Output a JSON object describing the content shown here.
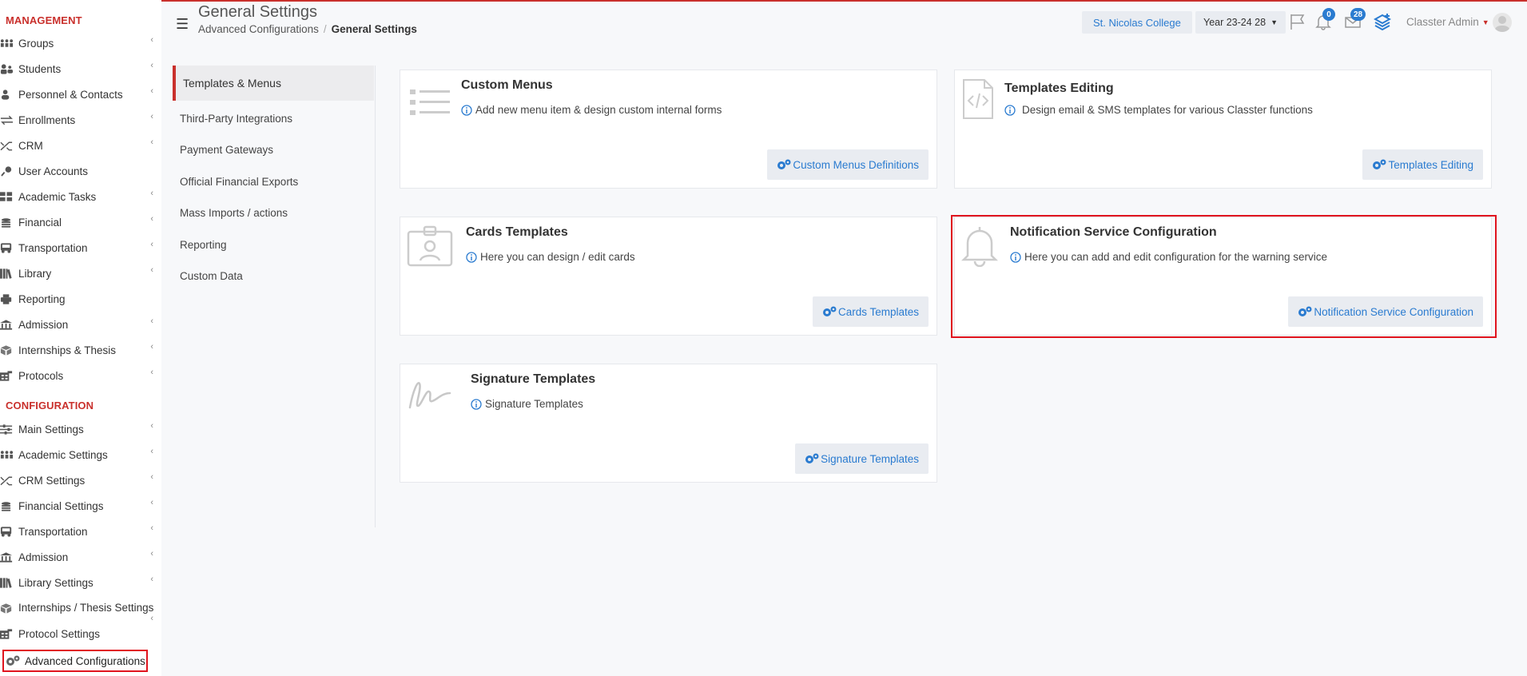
{
  "sidebar": {
    "management_heading": "MANAGEMENT",
    "management_items": [
      {
        "label": "Groups",
        "icon": "groups-icon",
        "chevron": true
      },
      {
        "label": "Students",
        "icon": "students-icon",
        "chevron": true
      },
      {
        "label": "Personnel & Contacts",
        "icon": "person-icon",
        "chevron": true
      },
      {
        "label": "Enrollments",
        "icon": "swap-arrows-icon",
        "chevron": true
      },
      {
        "label": "CRM",
        "icon": "crm-arrows-icon",
        "chevron": true
      },
      {
        "label": "User Accounts",
        "icon": "user-key-icon",
        "chevron": false
      },
      {
        "label": "Academic Tasks",
        "icon": "grid-icon",
        "chevron": true
      },
      {
        "label": "Financial",
        "icon": "coins-icon",
        "chevron": true
      },
      {
        "label": "Transportation",
        "icon": "bus-icon",
        "chevron": true
      },
      {
        "label": "Library",
        "icon": "books-icon",
        "chevron": true
      },
      {
        "label": "Reporting",
        "icon": "printer-icon",
        "chevron": false
      },
      {
        "label": "Admission",
        "icon": "institution-icon",
        "chevron": true
      },
      {
        "label": "Internships & Thesis",
        "icon": "cube-icon",
        "chevron": true
      },
      {
        "label": "Protocols",
        "icon": "protocol-icon",
        "chevron": true
      }
    ],
    "configuration_heading": "CONFIGURATION",
    "configuration_items": [
      {
        "label": "Main Settings",
        "icon": "sliders-icon",
        "chevron": true
      },
      {
        "label": "Academic Settings",
        "icon": "groups-icon",
        "chevron": true
      },
      {
        "label": "CRM Settings",
        "icon": "crm-arrows-icon",
        "chevron": true
      },
      {
        "label": "Financial Settings",
        "icon": "coins-icon",
        "chevron": true
      },
      {
        "label": "Transportation",
        "icon": "bus-icon",
        "chevron": true
      },
      {
        "label": "Admission",
        "icon": "institution-icon",
        "chevron": true
      },
      {
        "label": "Library Settings",
        "icon": "books-icon",
        "chevron": true
      },
      {
        "label": "Internships / Thesis Settings",
        "icon": "cube-icon",
        "chevron": true
      },
      {
        "label": "Protocol Settings",
        "icon": "protocol-icon",
        "chevron": true
      }
    ],
    "advanced": {
      "label": "Advanced Configurations",
      "icon": "gears-icon"
    }
  },
  "header": {
    "title": "General Settings",
    "breadcrumb": [
      "Advanced Configurations",
      "General Settings"
    ],
    "college": "St. Nicolas College",
    "year": "Year 23-24 28",
    "notifications_count": "0",
    "messages_count": "28",
    "user_name": "Classter Admin"
  },
  "submenu": {
    "active": "Templates & Menus",
    "items": [
      "Third-Party Integrations",
      "Payment Gateways",
      "Official Financial Exports",
      "Mass Imports / actions",
      "Reporting",
      "Custom Data"
    ]
  },
  "cards": [
    {
      "title": "Custom Menus",
      "description": "Add new menu item & design custom internal forms",
      "button": "Custom Menus Definitions",
      "icon": "list-icon"
    },
    {
      "title": "Templates Editing",
      "description": "Design email & SMS templates for various Classter functions",
      "button": "Templates Editing",
      "icon": "code-file-icon"
    },
    {
      "title": "Cards Templates",
      "description": "Here you can design / edit cards",
      "button": "Cards Templates",
      "icon": "id-badge-icon"
    },
    {
      "title": "Notification Service Configuration",
      "description": "Here you can add and edit configuration for the warning service",
      "button": "Notification Service Configuration",
      "icon": "bell-icon"
    },
    {
      "title": "Signature Templates",
      "description": "Signature Templates",
      "button": "Signature Templates",
      "icon": "signature-icon"
    }
  ],
  "colors": {
    "accent_red": "#c9302c",
    "link_blue": "#2a7bd0",
    "highlight_red": "#e0141e"
  }
}
